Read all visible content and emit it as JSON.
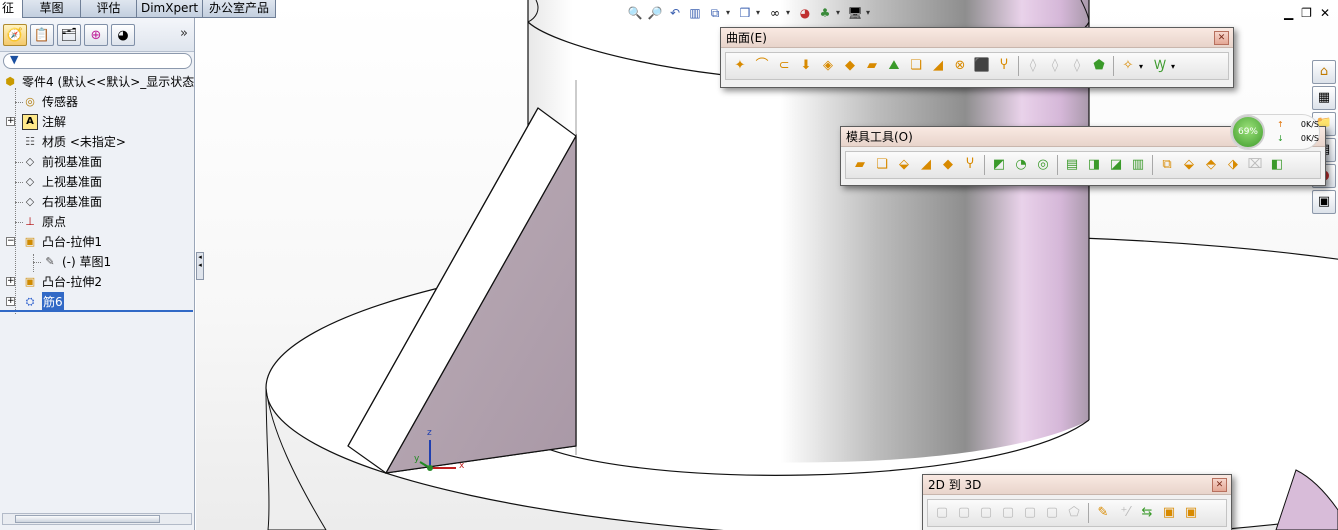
{
  "tabs": [
    "征",
    "草图",
    "评估",
    "DimXpert",
    "办公室产品"
  ],
  "panel": {
    "expand_glyph": "»",
    "filter_icon": "filter-icon",
    "tree": [
      {
        "label": "零件4 (默认<<默认>_显示状态",
        "icon": "part-icon"
      },
      {
        "label": "传感器",
        "icon": "sensor-icon"
      },
      {
        "label": "注解",
        "icon": "annotation-icon"
      },
      {
        "label": "材质 <未指定>",
        "icon": "material-icon"
      },
      {
        "label": "前视基准面",
        "icon": "plane-icon"
      },
      {
        "label": "上视基准面",
        "icon": "plane-icon"
      },
      {
        "label": "右视基准面",
        "icon": "plane-icon"
      },
      {
        "label": "原点",
        "icon": "origin-icon"
      },
      {
        "label": "凸台-拉伸1",
        "icon": "extrude-icon"
      },
      {
        "label": "(-) 草图1",
        "icon": "sketch-icon"
      },
      {
        "label": "凸台-拉伸2",
        "icon": "extrude-icon"
      },
      {
        "label": "筋6",
        "icon": "rib-icon"
      }
    ]
  },
  "toolbars": {
    "surface": {
      "title": "曲面(E)"
    },
    "mold": {
      "title": "模具工具(O)"
    },
    "to3d": {
      "title": "2D 到 3D"
    }
  },
  "net_meter": {
    "percent": "69%",
    "up": "0K/S",
    "down": "0K/S"
  },
  "triad": {
    "x": "x",
    "y": "y",
    "z": "z"
  }
}
